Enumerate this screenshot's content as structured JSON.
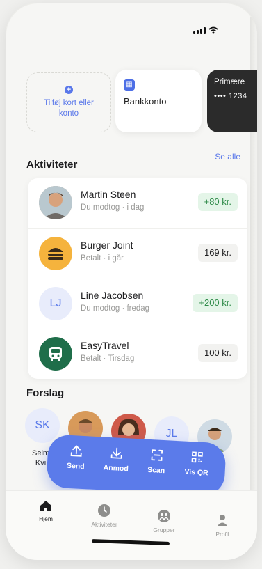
{
  "cards": {
    "add_label": "Tilføj kort eller konto",
    "bank_label": "Bankkonto",
    "primary_title": "Primære",
    "primary_number": "•••• 1234"
  },
  "activities": {
    "title": "Aktiviteter",
    "see_all": "Se alle",
    "items": [
      {
        "name": "Martin Steen",
        "sub": "Du modtog · i dag",
        "amount": "+80 kr.",
        "type": "received",
        "avatar": "photo"
      },
      {
        "name": "Burger Joint",
        "sub": "Betalt · i går",
        "amount": "169 kr.",
        "type": "paid",
        "avatar": "burger-icon"
      },
      {
        "name": "Line Jacobsen",
        "sub": "Du modtog · fredag",
        "amount": "+200 kr.",
        "type": "received",
        "avatar": "LJ"
      },
      {
        "name": "EasyTravel",
        "sub": "Betalt · Tirsdag",
        "amount": "100 kr.",
        "type": "paid",
        "avatar": "bus-icon"
      }
    ]
  },
  "suggestions": {
    "title": "Forslag",
    "people": [
      {
        "initials": "SK",
        "label_line1": "Selm",
        "label_line2": "Kvi"
      },
      {
        "initials": "",
        "label_line1": "",
        "label_line2": ""
      },
      {
        "initials": "",
        "label_line1": "",
        "label_line2": ""
      },
      {
        "initials": "JL",
        "label_line1": "",
        "label_line2": ""
      },
      {
        "initials": "",
        "label_line1": "el",
        "label_line2": "..."
      }
    ]
  },
  "actions": [
    {
      "label": "Send",
      "icon": "upload-icon"
    },
    {
      "label": "Anmod",
      "icon": "download-icon"
    },
    {
      "label": "Scan",
      "icon": "scan-icon"
    },
    {
      "label": "Vis QR",
      "icon": "qr-icon"
    }
  ],
  "tabs": [
    {
      "label": "Hjem",
      "icon": "home-icon",
      "active": true
    },
    {
      "label": "Aktiviteter",
      "icon": "clock-icon",
      "active": false
    },
    {
      "label": "Grupper",
      "icon": "group-icon",
      "active": false
    },
    {
      "label": "Profil",
      "icon": "person-icon",
      "active": false
    }
  ],
  "colors": {
    "accent": "#5b7bea",
    "positive_bg": "#e4f5e8",
    "positive_text": "#2e8a48",
    "dark_card": "#2b2b2b"
  }
}
